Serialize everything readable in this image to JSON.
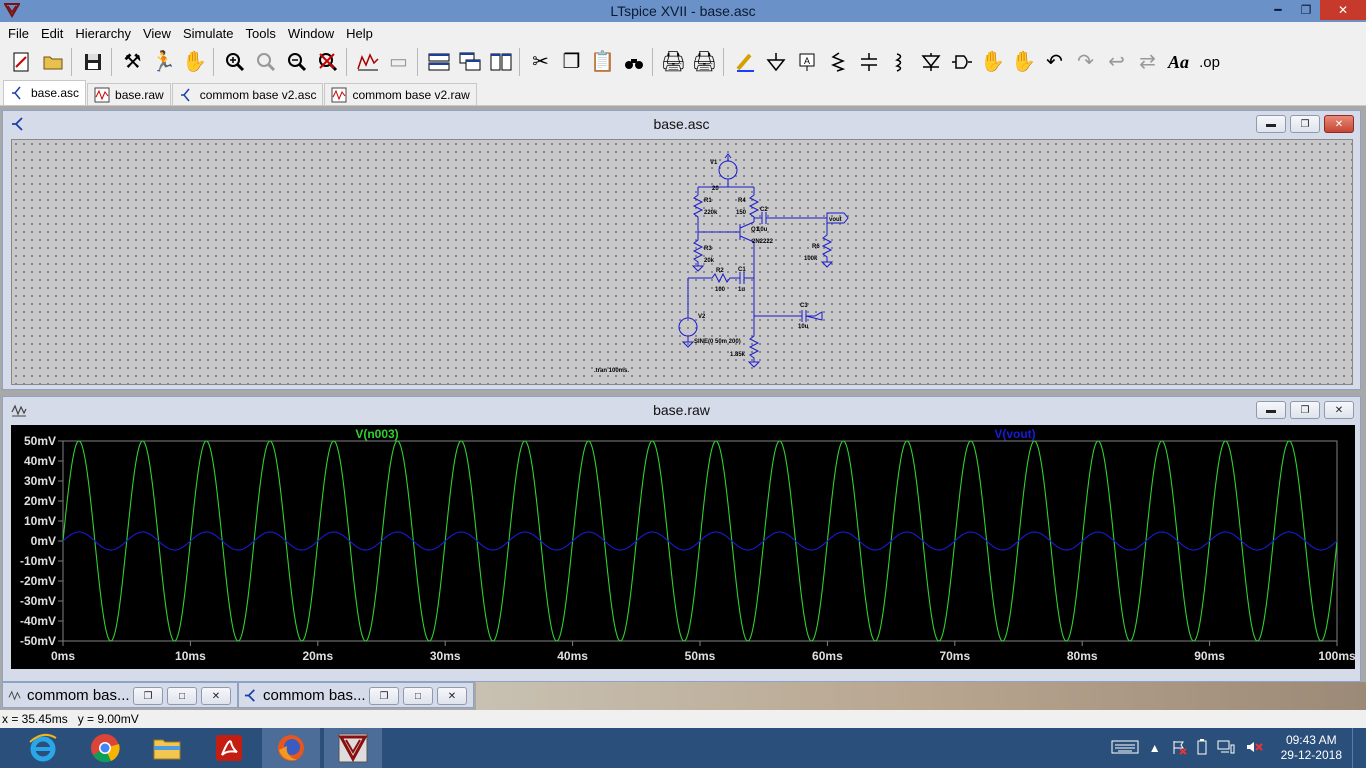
{
  "app": {
    "title": "LTspice XVII - base.asc"
  },
  "menu": [
    "File",
    "Edit",
    "Hierarchy",
    "View",
    "Simulate",
    "Tools",
    "Window",
    "Help"
  ],
  "toolbar": {
    "icons": [
      "new-schematic-icon",
      "open-icon",
      "save-icon",
      "control-panel-icon",
      "run-icon",
      "pan-hand-icon",
      "zoom-in-icon",
      "zoom-fit-icon",
      "zoom-out-icon",
      "zoom-cancel-icon",
      "autorange-icon",
      "window-icon",
      "tile-horizontal-icon",
      "cascade-icon",
      "tile-icon",
      "cut-icon",
      "copy-icon",
      "paste-icon",
      "find-icon",
      "print-icon",
      "print-setup-icon",
      "draw-wire-icon",
      "ground-icon",
      "label-net-icon",
      "resistor-icon",
      "capacitor-icon",
      "inductor-icon",
      "diode-icon",
      "component-icon",
      "move-icon",
      "drag-icon",
      "undo-icon",
      "redo-icon",
      "rotate-icon",
      "mirror-icon"
    ],
    "text_label": "Aa",
    "op_label": ".op"
  },
  "tabs": [
    {
      "label": "base.asc",
      "active": true,
      "kind": "schematic"
    },
    {
      "label": "base.raw",
      "active": false,
      "kind": "waveform"
    },
    {
      "label": "commom base v2.asc",
      "active": false,
      "kind": "schematic"
    },
    {
      "label": "commom base v2.raw",
      "active": false,
      "kind": "waveform"
    }
  ],
  "schematic_window": {
    "title": "base.asc",
    "labels": {
      "v1": "V1",
      "v1_val": "20",
      "r1": "R1",
      "r1_val": "220k",
      "r4": "R4",
      "r4_val": "150",
      "c2": "C2",
      "c2_val": "10u",
      "q1": "Q1",
      "q1_val": "2N2222",
      "vout": "vout",
      "r6": "R6",
      "r6_val": "100k",
      "r3": "R3",
      "r3_val": "20k",
      "r2": "R2",
      "r2_val": "100",
      "c1": "C1",
      "c1_val": "1u",
      "c3": "C3",
      "c3_val": "10u",
      "v2": "V2",
      "v2_val": "SINE(0 50m 200)",
      "r5_val": "1.85k",
      "tran": ".tran 100ms."
    }
  },
  "waveform_window": {
    "title": "base.raw",
    "colors": {
      "n003": "#30d030",
      "vout": "#1a1ad8",
      "bg": "#000000",
      "axis_text": "#e0e0e0"
    }
  },
  "chart_data": {
    "type": "line",
    "series": [
      {
        "name": "V(n003)",
        "amplitude_mV": 50,
        "frequency_Hz": 200,
        "offset_mV": 0
      },
      {
        "name": "V(vout)",
        "amplitude_mV": 4.5,
        "frequency_Hz": 200,
        "offset_mV": 0
      }
    ],
    "xlim": [
      0,
      100
    ],
    "ylim": [
      -50,
      50
    ],
    "xticks": [
      "0ms",
      "10ms",
      "20ms",
      "30ms",
      "40ms",
      "50ms",
      "60ms",
      "70ms",
      "80ms",
      "90ms",
      "100ms"
    ],
    "yticks": [
      "50mV",
      "40mV",
      "30mV",
      "20mV",
      "10mV",
      "0mV",
      "-10mV",
      "-20mV",
      "-30mV",
      "-40mV",
      "-50mV"
    ],
    "grid": false
  },
  "minimized": [
    {
      "label": "commom bas..."
    },
    {
      "label": "commom bas..."
    }
  ],
  "status": {
    "text": "x = 35.45ms   y = 9.00mV"
  },
  "taskbar": {
    "apps": [
      "internet-explorer-icon",
      "chrome-icon",
      "file-explorer-icon",
      "acrobat-icon",
      "firefox-icon",
      "ltspice-icon"
    ],
    "time": "09:43 AM",
    "date": "29-12-2018"
  }
}
